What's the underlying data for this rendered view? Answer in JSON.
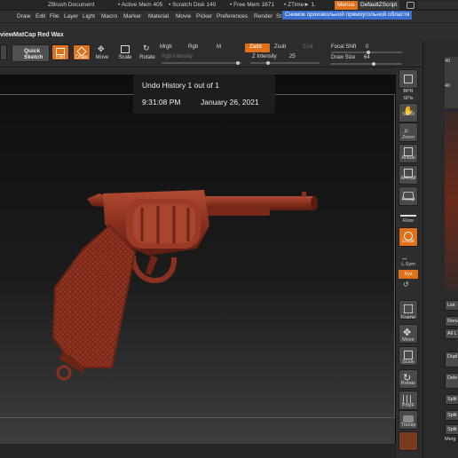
{
  "titlebar": {
    "app": "ZBrush Document",
    "active_mem": "• Active Mem 405",
    "scratch_disk": "• Scratch Disk 140",
    "free_mem": "• Free Mem 1671",
    "ztime": "• ZTime► 1.",
    "menus_btn": "Menus",
    "script_btn": "DefaultZScript",
    "status_text": "Снимок произвольной прямоугольной области"
  },
  "menubar": [
    "Draw",
    "Edit",
    "File",
    "Layer",
    "Light",
    "Macro",
    "Marker",
    "Material",
    "Movie",
    "Picker",
    "Preferences",
    "Render",
    "St"
  ],
  "material_label": "viewMatCap Red Wax",
  "toolbar": {
    "quick_sketch": [
      "Quick",
      "Sketch"
    ],
    "edit": "Edit",
    "draw": "Draw",
    "move": "Move",
    "scale": "Scale",
    "rotate": "Rotate",
    "mrgb": "Mrgb",
    "rgb": "Rgb",
    "m": "M",
    "rgb_intensity": "Rgb Intensity",
    "zadd": "Zadd",
    "zsub": "Zsub",
    "zcut": "Zcut",
    "z_intensity_label": "Z Intensity",
    "z_intensity_value": "25",
    "focal_shift_label": "Focal Shift",
    "focal_shift_value": "0",
    "draw_size_label": "Draw Size",
    "draw_size_value": "64"
  },
  "undo_overlay": {
    "title": "Undo History 1 out of 1",
    "time": "9:31:08 PM",
    "date": "January 26, 2021"
  },
  "shelf": [
    "BPR",
    "SPix",
    "Scroll",
    "Zoom",
    "Actual",
    "AAHalf",
    "Persp",
    "Floor",
    "Local",
    "L.Sym",
    "Frame",
    "Move",
    "Scale",
    "Rotate",
    "PolyF",
    "Transp"
  ],
  "shelf_xyz": "Xyz",
  "right_panel": [
    "List",
    "Rena",
    "All L",
    "Dupl",
    "Dele",
    "Split",
    "Split",
    "Split",
    "Merg"
  ],
  "right_panel_values": [
    "40",
    "40"
  ],
  "colors": {
    "accent": "#e0701a",
    "model": "#8a3020",
    "status_blue": "#3a6fd0"
  }
}
